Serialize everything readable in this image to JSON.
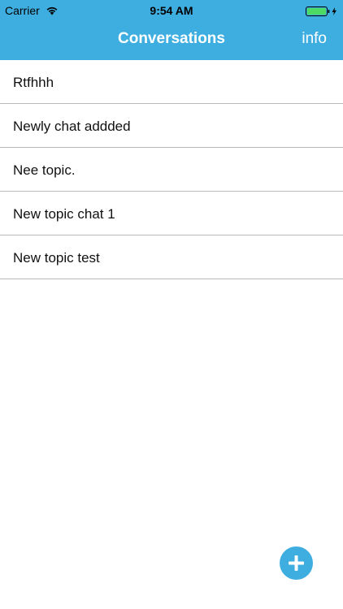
{
  "status_bar": {
    "carrier": "Carrier",
    "time": "9:54 AM",
    "wifi_icon": "wifi-icon",
    "battery_icon": "battery-charging-icon",
    "battery_color": "#4cd964"
  },
  "nav": {
    "title": "Conversations",
    "info_label": "info",
    "background_color": "#3eaee0"
  },
  "conversations": [
    {
      "title": "Rtfhhh"
    },
    {
      "title": "Newly chat addded"
    },
    {
      "title": "Nee topic."
    },
    {
      "title": "New topic chat 1"
    },
    {
      "title": "New topic test"
    }
  ],
  "fab": {
    "icon": "plus-icon",
    "color": "#3eaee0"
  }
}
